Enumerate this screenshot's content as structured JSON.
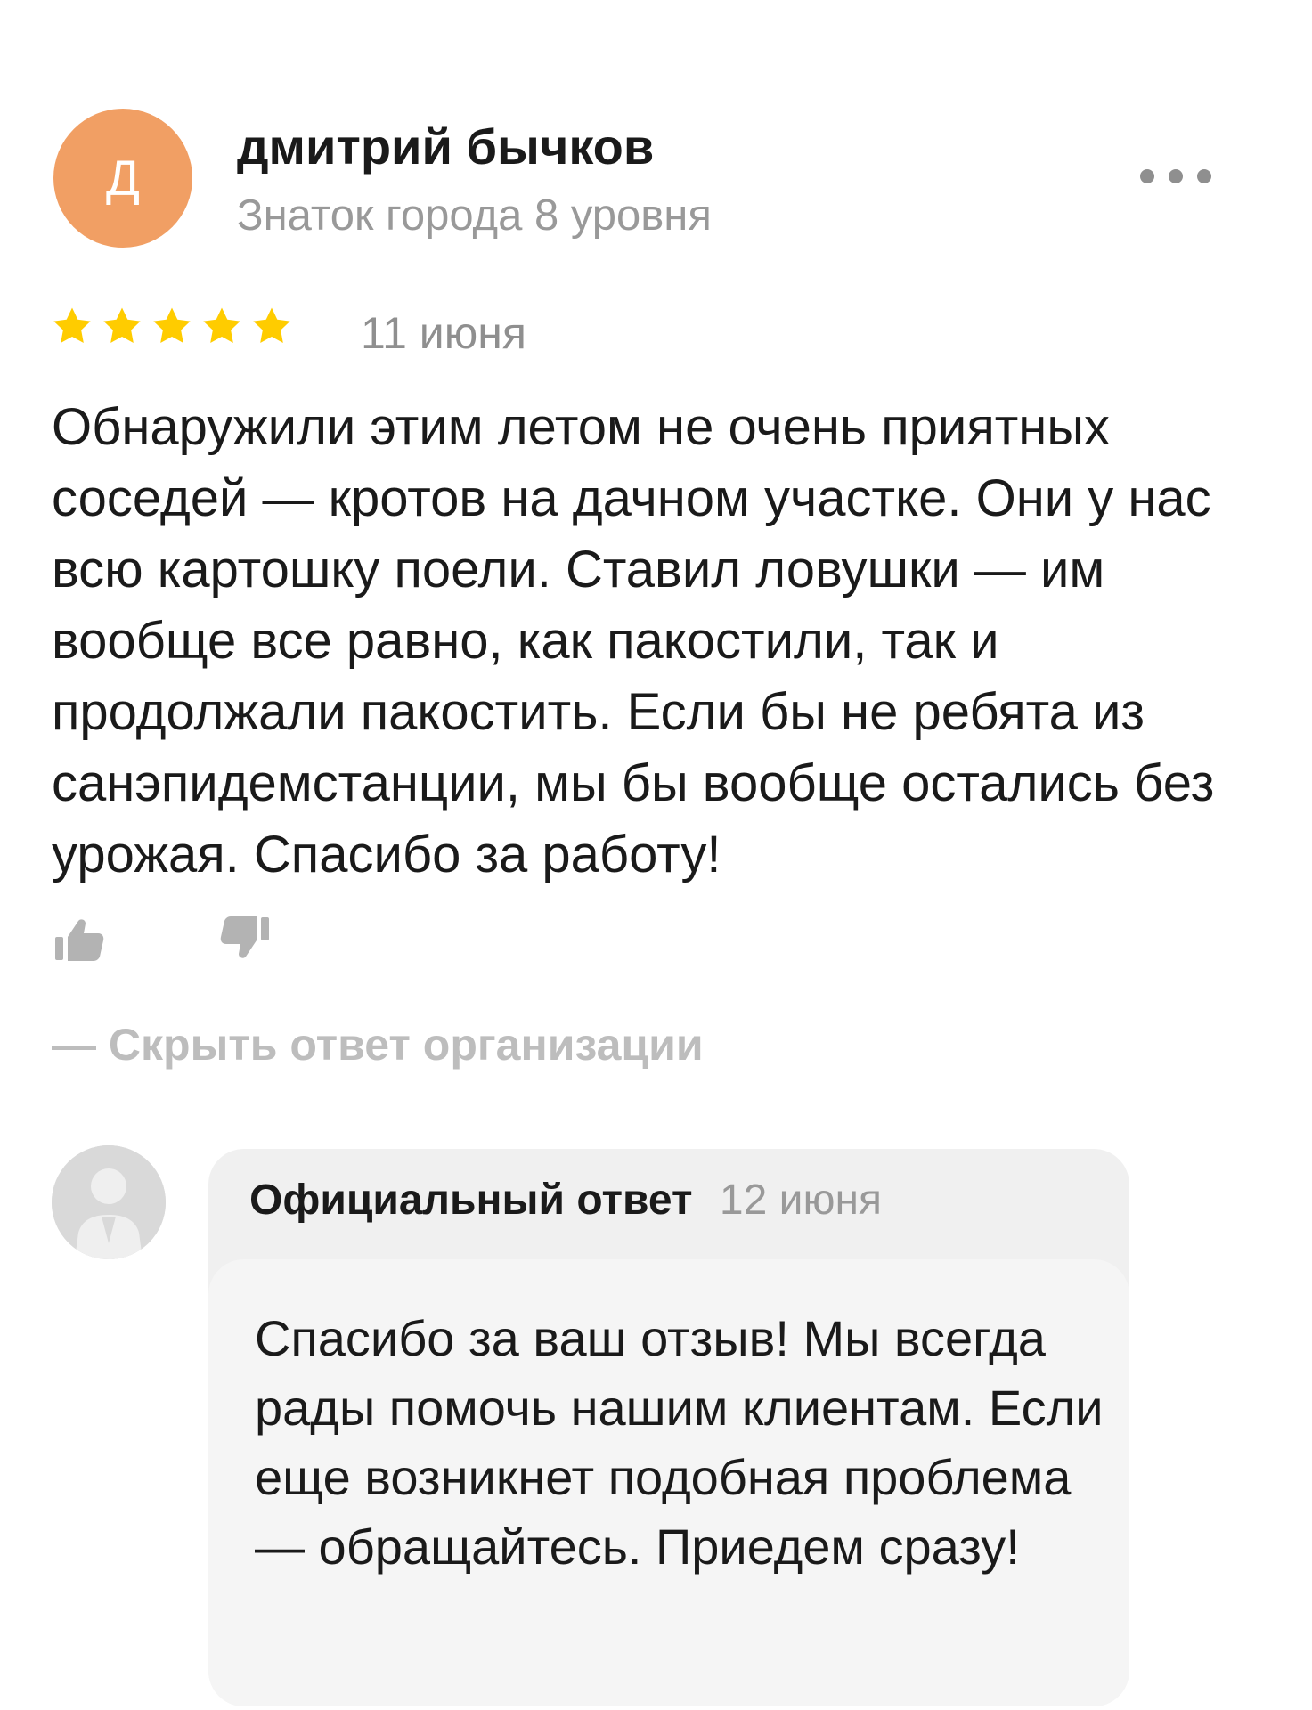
{
  "review": {
    "author": {
      "initial": "Д",
      "name": "дмитрий бычков",
      "level": "Знаток города 8 уровня",
      "avatar_color": "#f19f64"
    },
    "menu_icon": "more-dots-icon",
    "rating": 5,
    "star_color": "#ffcc00",
    "date": "11 июня",
    "text": "Обнаружили этим летом не очень приятных соседей — кротов на дачном участке. Они у нас всю картошку поели. Ставил ловушки — им вообще все равно, как пакостили, так и продолжали пакостить. Если бы не ребята из санэпидемстанции, мы бы вообще остались без урожая. Спасибо за работу!",
    "reactions": {
      "like_icon": "thumbs-up-icon",
      "dislike_icon": "thumbs-down-icon"
    },
    "hide_reply_label": "— Скрыть ответ организации"
  },
  "reply": {
    "avatar_icon": "person-silhouette-icon",
    "title": "Официальный ответ",
    "date": "12 июня",
    "text": "Спасибо за ваш отзыв! Мы всегда рады помочь нашим клиентам. Если еще возникнет подобная проблема — обращайтесь. Приедем сразу!"
  }
}
